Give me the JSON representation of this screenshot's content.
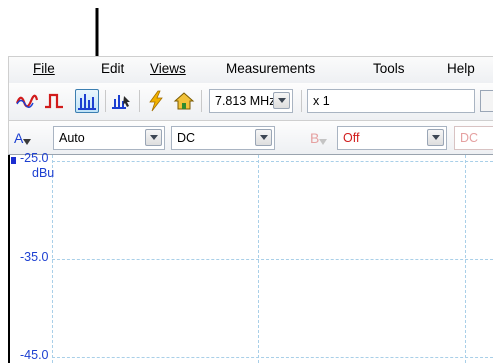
{
  "menu": {
    "file": "File",
    "edit": "Edit",
    "views": "Views",
    "measurements": "Measurements",
    "tools": "Tools",
    "help": "Help"
  },
  "toolbar": {
    "frequency": "7.813 MHz",
    "multiplier": "x 1"
  },
  "channel_a": {
    "label": "A",
    "range": "Auto",
    "coupling": "DC"
  },
  "channel_b": {
    "label": "B",
    "range": "Off",
    "coupling": "DC"
  },
  "plot": {
    "y_ticks": [
      "-25.0",
      "-35.0",
      "-45.0"
    ],
    "y_unit": "dBu"
  },
  "colors": {
    "accent": "#1c3fd1",
    "grid": "#a9cfe8",
    "active_button": "#bfe3f7"
  }
}
